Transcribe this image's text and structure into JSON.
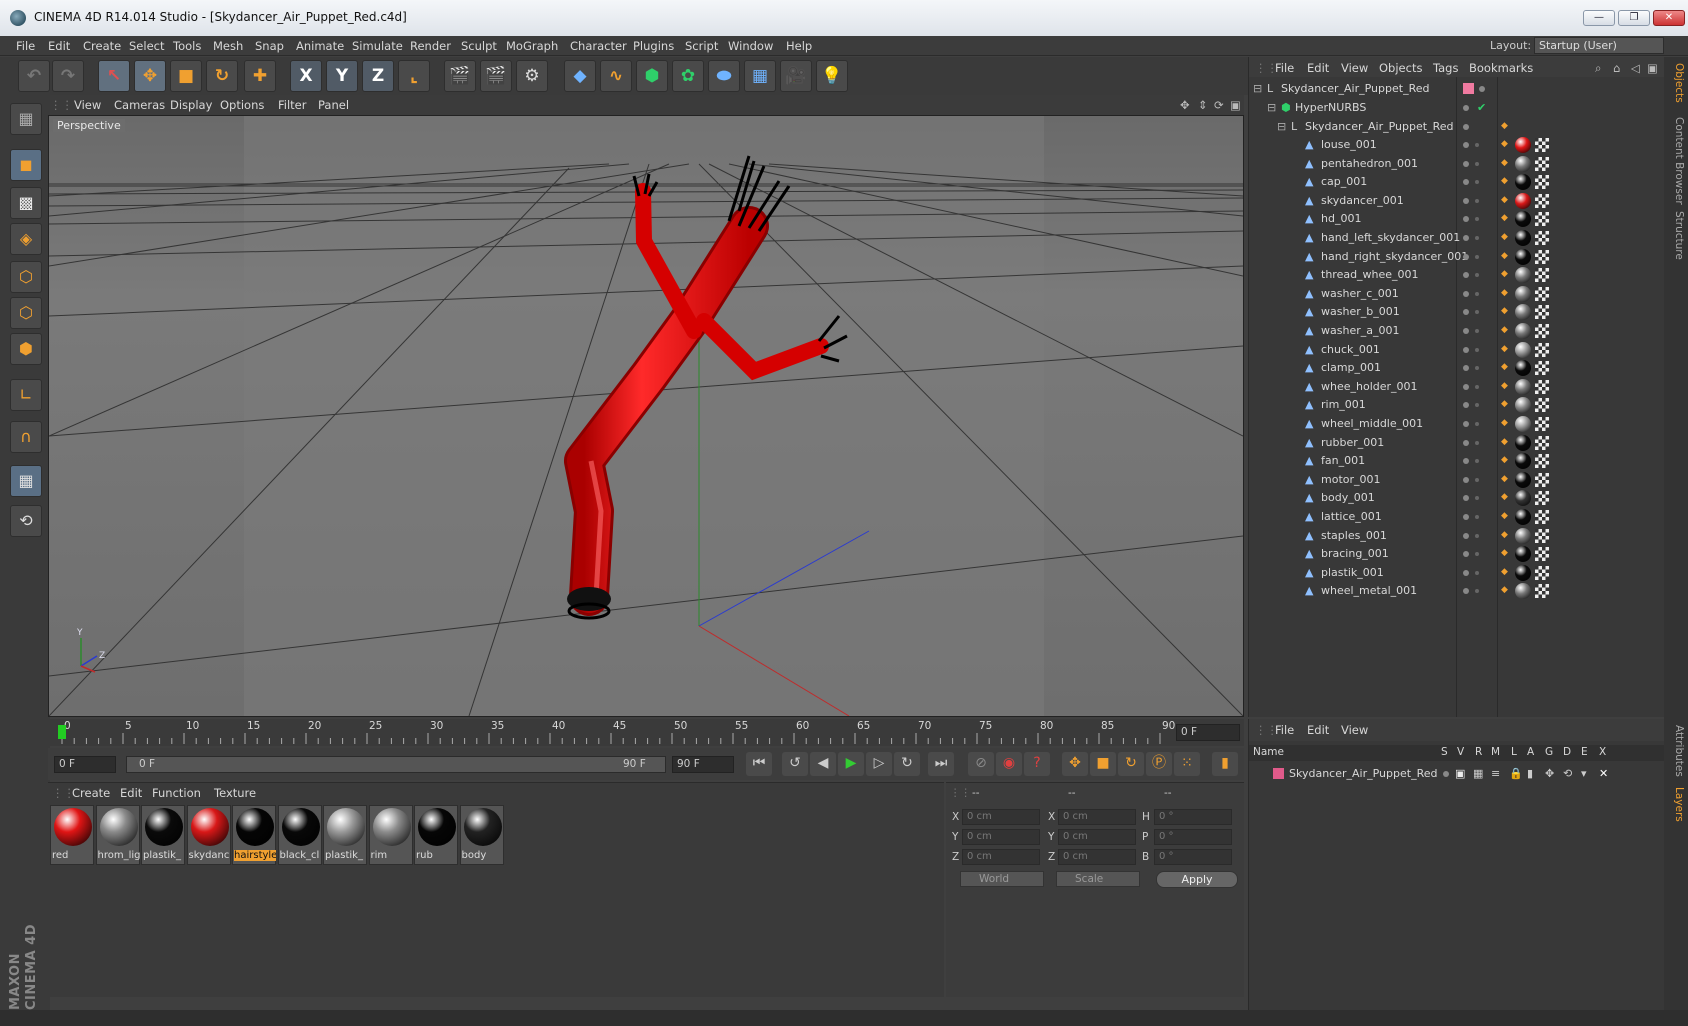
{
  "window": {
    "title": "CINEMA 4D R14.014 Studio - [Skydancer_Air_Puppet_Red.c4d]",
    "controls": [
      "—",
      "❐",
      "✕"
    ]
  },
  "menu": [
    "File",
    "Edit",
    "Create",
    "Select",
    "Tools",
    "Mesh",
    "Snap",
    "Animate",
    "Simulate",
    "Render",
    "Sculpt",
    "MoGraph",
    "Character",
    "Plugins",
    "Script",
    "Window",
    "Help"
  ],
  "layout": {
    "label": "Layout:",
    "value": "Startup (User)"
  },
  "toolbar": {
    "axis_x": "X",
    "axis_y": "Y",
    "axis_z": "Z"
  },
  "viewport": {
    "menu": [
      "View",
      "Cameras",
      "Display",
      "Options",
      "Filter",
      "Panel"
    ],
    "label": "Perspective",
    "axis_y": "Y",
    "axis_z": "Z"
  },
  "timeline": {
    "ticks": [
      "0",
      "5",
      "10",
      "15",
      "20",
      "25",
      "30",
      "35",
      "40",
      "45",
      "50",
      "55",
      "60",
      "65",
      "70",
      "75",
      "80",
      "85",
      "90"
    ],
    "current_frame": "0 F",
    "start_field": "0 F",
    "range_start": "0 F",
    "range_end": "90 F",
    "end_field": "90 F"
  },
  "materials": {
    "menu": [
      "Create",
      "Edit",
      "Function",
      "Texture"
    ],
    "items": [
      {
        "name": "red",
        "color": "#e01515"
      },
      {
        "name": "hrom_lig",
        "color": "#8a8a8a"
      },
      {
        "name": "plastik_",
        "color": "#0a0a0a"
      },
      {
        "name": "skydanc",
        "color": "#d81818"
      },
      {
        "name": "hairstyle",
        "color": "#050505"
      },
      {
        "name": "black_cl",
        "color": "#080808"
      },
      {
        "name": "plastik_",
        "color": "#9a9a9a"
      },
      {
        "name": "rim",
        "color": "#8c8c8c"
      },
      {
        "name": "rub",
        "color": "#060606"
      },
      {
        "name": "body",
        "color": "#222222"
      }
    ],
    "selected_index": 4
  },
  "coordinates": {
    "header": [
      "--",
      "--",
      "--"
    ],
    "rows": [
      {
        "a": "X",
        "av": "0 cm",
        "b": "X",
        "bv": "0 cm",
        "c": "H",
        "cv": "0 °"
      },
      {
        "a": "Y",
        "av": "0 cm",
        "b": "Y",
        "bv": "0 cm",
        "c": "P",
        "cv": "0 °"
      },
      {
        "a": "Z",
        "av": "0 cm",
        "b": "Z",
        "bv": "0 cm",
        "c": "B",
        "cv": "0 °"
      }
    ],
    "space": "World",
    "mode": "Scale",
    "apply": "Apply"
  },
  "objects": {
    "menu": [
      "File",
      "Edit",
      "View",
      "Objects",
      "Tags",
      "Bookmarks"
    ],
    "root": "Skydancer_Air_Puppet_Red",
    "hypernurbs": "HyperNURBS",
    "group": "Skydancer_Air_Puppet_Red",
    "children": [
      {
        "name": "louse_001",
        "tag": "#e01515"
      },
      {
        "name": "pentahedron_001",
        "tag": "#777777"
      },
      {
        "name": "cap_001",
        "tag": "#0a0a0a"
      },
      {
        "name": "skydancer_001",
        "tag": "#d81818"
      },
      {
        "name": "hd_001",
        "tag": "#0a0a0a"
      },
      {
        "name": "hand_left_skydancer_001",
        "tag": "#0a0a0a"
      },
      {
        "name": "hand_right_skydancer_001",
        "tag": "#0a0a0a"
      },
      {
        "name": "thread_whee_001",
        "tag": "#777777"
      },
      {
        "name": "washer_c_001",
        "tag": "#777777"
      },
      {
        "name": "washer_b_001",
        "tag": "#777777"
      },
      {
        "name": "washer_a_001",
        "tag": "#777777"
      },
      {
        "name": "chuck_001",
        "tag": "#9a9a9a"
      },
      {
        "name": "clamp_001",
        "tag": "#0a0a0a"
      },
      {
        "name": "whee_holder_001",
        "tag": "#777777"
      },
      {
        "name": "rim_001",
        "tag": "#888888"
      },
      {
        "name": "wheel_middle_001",
        "tag": "#9a9a9a"
      },
      {
        "name": "rubber_001",
        "tag": "#0a0a0a"
      },
      {
        "name": "fan_001",
        "tag": "#0a0a0a"
      },
      {
        "name": "motor_001",
        "tag": "#0a0a0a"
      },
      {
        "name": "body_001",
        "tag": "#333333"
      },
      {
        "name": "lattice_001",
        "tag": "#0a0a0a"
      },
      {
        "name": "staples_001",
        "tag": "#777777"
      },
      {
        "name": "bracing_001",
        "tag": "#0a0a0a"
      },
      {
        "name": "plastik_001",
        "tag": "#0a0a0a"
      },
      {
        "name": "wheel_metal_001",
        "tag": "#777777"
      }
    ]
  },
  "layers": {
    "menu": [
      "File",
      "Edit",
      "View"
    ],
    "columns": [
      "Name",
      "S",
      "V",
      "R",
      "M",
      "L",
      "A",
      "G",
      "D",
      "E",
      "X"
    ],
    "rows": [
      {
        "name": "Skydancer_Air_Puppet_Red",
        "color": "#e05a8a"
      }
    ]
  },
  "side_tabs": [
    "Objects",
    "Content Browser",
    "Structure",
    "Attributes",
    "Layers"
  ],
  "brand": "MAXON CINEMA 4D",
  "colors": {
    "accent": "#f0a030",
    "puppet": "#e01515",
    "selection": "#5a6f85"
  }
}
